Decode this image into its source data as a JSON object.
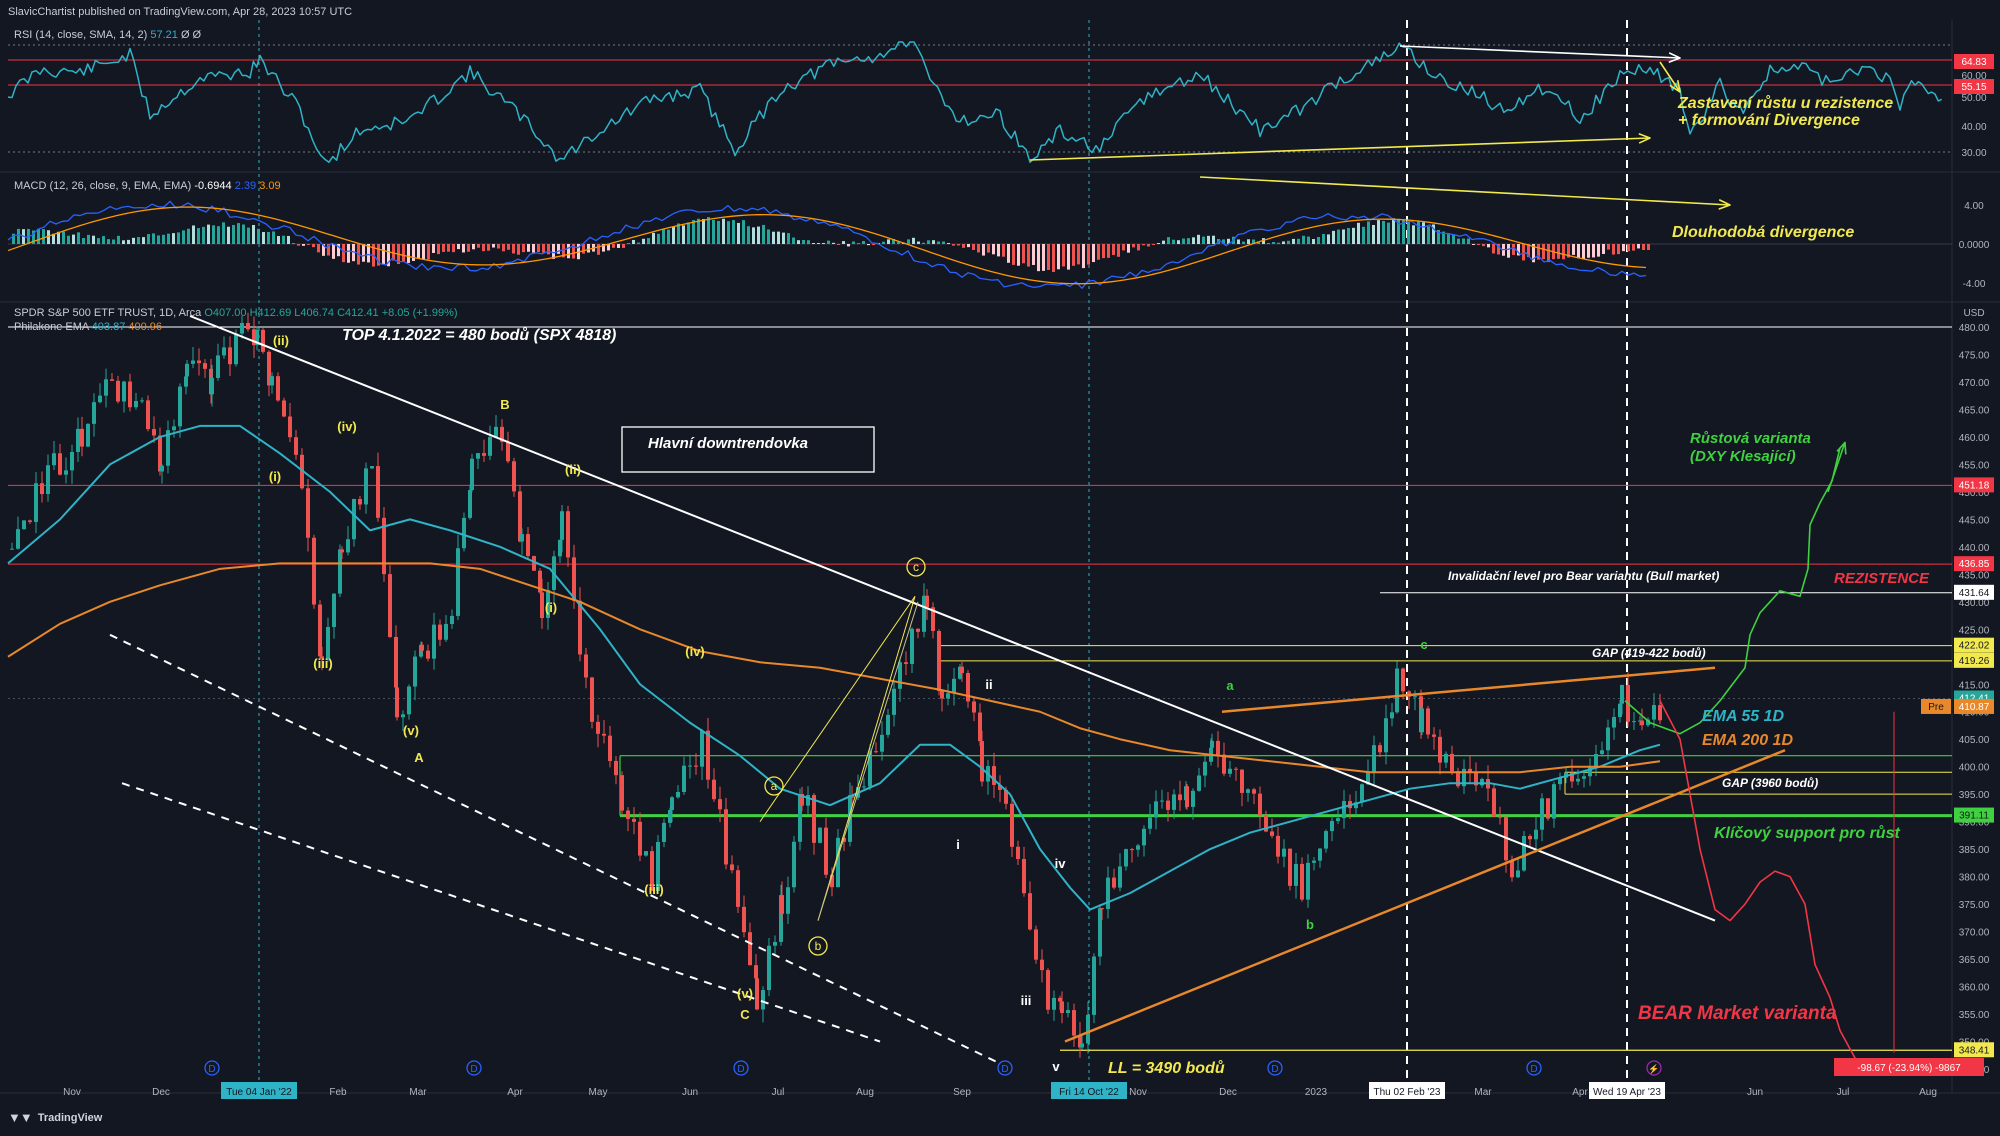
{
  "header": {
    "published_by": "SlavicChartist published on TradingView.com, Apr 28, 2023 10:57 UTC"
  },
  "footer": {
    "brand": "TradingView"
  },
  "colors": {
    "bg": "#131722",
    "grid": "#2a2e39",
    "up": "#26a69a",
    "down": "#ef5350",
    "ema55": "#2fb3c7",
    "ema200": "#e8882a",
    "annot_yellow": "#f2e94e",
    "annot_green": "#3fd13f",
    "annot_red": "#f23645",
    "white": "#ffffff"
  },
  "rsi": {
    "label": "RSI (14, close, SMA, 14, 2)",
    "value": "57.21",
    "extra": "Ø Ø",
    "axis_ticks": [
      "64.83",
      "60.00",
      "55.15",
      "50.00",
      "40.00",
      "30.00"
    ],
    "annotation": "Zastavení růstu u rezistence\n+ formování Divergence"
  },
  "macd": {
    "label": "MACD (12, 26, close, 9, EMA, EMA)",
    "values": [
      "-0.6944",
      "2.39",
      "3.09"
    ],
    "axis_ticks": [
      "4.00",
      "0.0000",
      "-4.00"
    ],
    "annotation": "Dlouhodobá divergence"
  },
  "price": {
    "label": "SPDR S&P 500 ETF TRUST, 1D, Arca",
    "ohlc": "O407.00 H412.69 L406.74 C412.41 +8.05 (+1.99%)",
    "ema_label": "Philakone EMA",
    "ema_values": [
      "403.87",
      "400.96"
    ],
    "currency": "USD",
    "axis_ticks": [
      "480.00",
      "475.00",
      "470.00",
      "465.00",
      "460.00",
      "455.00",
      "450.00",
      "445.00",
      "440.00",
      "435.00",
      "430.00",
      "425.00",
      "420.00",
      "415.00",
      "410.00",
      "405.00",
      "400.00",
      "395.00",
      "390.00",
      "385.00",
      "380.00",
      "375.00",
      "370.00",
      "365.00",
      "360.00",
      "355.00",
      "350.00",
      "345.00"
    ],
    "level_badges": [
      {
        "text": "451.18",
        "color": "#f23645"
      },
      {
        "text": "436.85",
        "color": "#f23645"
      },
      {
        "text": "431.64",
        "color": "#ffffff"
      },
      {
        "text": "422.02",
        "color": "#f2e94e"
      },
      {
        "text": "419.26",
        "color": "#f2e94e"
      },
      {
        "text": "412.41",
        "color": "#26a69a"
      },
      {
        "text": "410.87",
        "color": "#e8882a"
      },
      {
        "text": "391.11",
        "color": "#3fd13f"
      },
      {
        "text": "348.41",
        "color": "#f2e94e"
      }
    ],
    "pre_tag": "Pre",
    "measure_tag": "-98.67 (-23.94%) -9867"
  },
  "x_axis": {
    "labels": [
      "Nov",
      "Dec",
      "Tue 04 Jan '22",
      "Feb",
      "Mar",
      "Apr",
      "May",
      "Jun",
      "Jul",
      "Aug",
      "Sep",
      "Fri 14 Oct '22",
      "Nov",
      "Dec",
      "2023",
      "Thu 02 Feb '23",
      "Mar",
      "Apr",
      "Wed 19 Apr '23",
      "Jun",
      "Jul",
      "Aug"
    ]
  },
  "annotations": {
    "top": "TOP 4.1.2022 = 480 bodů (SPX 4818)",
    "main_trendline": "Hlavní downtrendovka",
    "growth_variant": "Růstová varianta\n(DXY Klesající)",
    "invalidation": "Invalidační level pro Bear variantu (Bull market)",
    "resistance": "REZISTENCE",
    "gap_high": "GAP (419-422 bodů)",
    "ema55": "EMA 55 1D",
    "ema200": "EMA 200 1D",
    "gap_low": "GAP (3960 bodů)",
    "key_support": "Klíčový support pro růst",
    "bear_variant": "BEAR Market varianta",
    "ll": "LL = 3490 bodů"
  },
  "wave_labels": {
    "ii_top": "(ii)",
    "iv_1": "(iv)",
    "i_1": "(i)",
    "iii_1": "(iii)",
    "v_1": "(v)",
    "A": "A",
    "B": "B",
    "ii_2": "(ii)",
    "i_2": "(i)",
    "iv_2": "(iv)",
    "iii_2": "(iii)",
    "v_2": "(v)",
    "C": "C",
    "c_circ": "c",
    "a_circ": "a",
    "b_circ": "b",
    "ii_s": "ii",
    "i_s": "i",
    "iv_s": "iv",
    "iii_s": "iii",
    "v_s": "v",
    "a_s": "a",
    "b_s": "b",
    "c_s": "c",
    "D": "D"
  },
  "chart_data": {
    "type": "candlestick",
    "title": "SPDR S&P 500 ETF TRUST, 1D, Arca",
    "ylabel": "USD",
    "ylim": [
      345,
      480
    ],
    "x": [
      "2021-11",
      "2021-12",
      "2022-01",
      "2022-02",
      "2022-03",
      "2022-04",
      "2022-05",
      "2022-06",
      "2022-07",
      "2022-08",
      "2022-09",
      "2022-10",
      "2022-11",
      "2022-12",
      "2023-01",
      "2023-02",
      "2023-03",
      "2023-04"
    ],
    "series": [
      {
        "name": "close (approx.)",
        "values": [
          466,
          472,
          451,
          437,
          452,
          412,
          412,
          377,
          412,
          396,
          358,
          386,
          407,
          383,
          406,
          409,
          409,
          412
        ]
      },
      {
        "name": "EMA 55 1D",
        "values": [
          450,
          460,
          462,
          448,
          440,
          432,
          416,
          400,
          392,
          400,
          392,
          375,
          378,
          386,
          392,
          398,
          400,
          403.87
        ]
      },
      {
        "name": "EMA 200 1D",
        "values": [
          425,
          432,
          436,
          440,
          440,
          438,
          432,
          424,
          418,
          414,
          410,
          404,
          400,
          398,
          398,
          398,
          399,
          400.96
        ]
      }
    ],
    "levels": [
      451.18,
      436.85,
      431.64,
      422.02,
      419.26,
      391.11,
      348.41
    ]
  }
}
